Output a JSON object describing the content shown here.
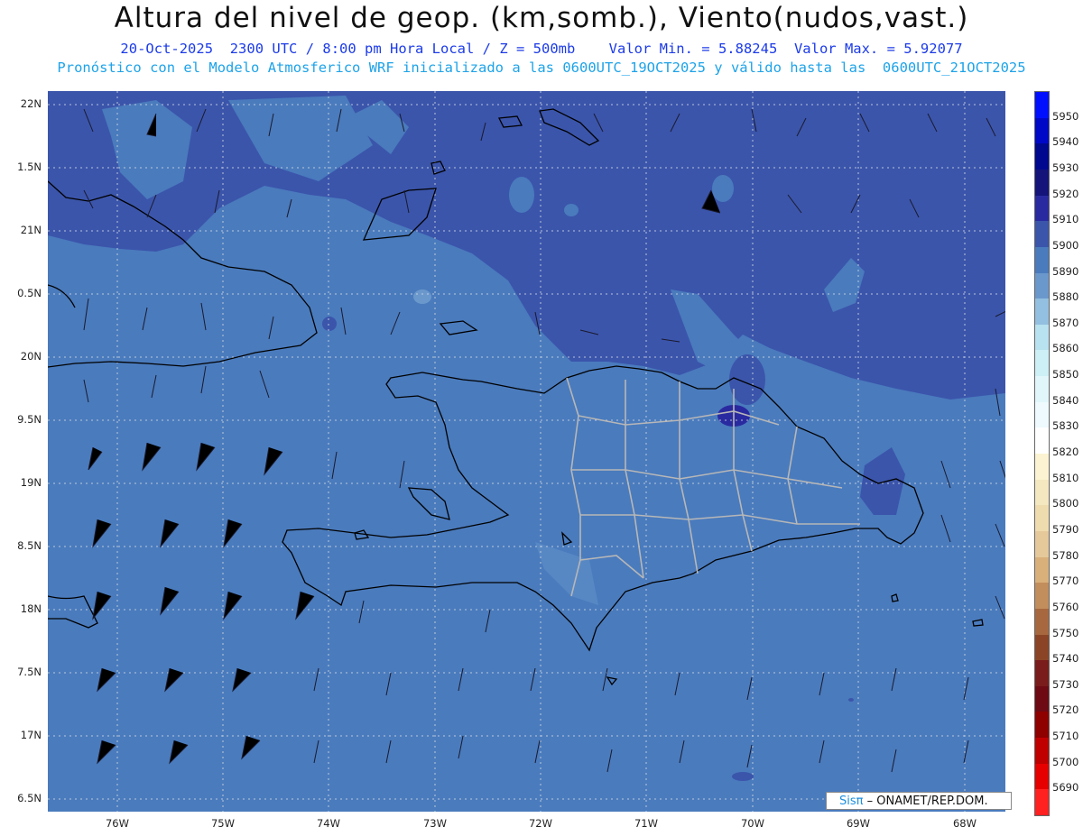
{
  "header": {
    "title": "Altura del nivel de geop. (km,somb.), Viento(nudos,vast.)",
    "line1": "20-Oct-2025  2300 UTC / 8:00 pm Hora Local / Z = 500mb    Valor Min. = 5.88245  Valor Max. = 5.92077",
    "line2": "Pronóstico con el Modelo Atmosferico WRF inicializado a las 0600UTC_19OCT2025 y válido hasta las  0600UTC_21OCT2025"
  },
  "axes": {
    "lat_labels": [
      "22N",
      "1.5N",
      "21N",
      "0.5N",
      "20N",
      "9.5N",
      "19N",
      "8.5N",
      "18N",
      "7.5N",
      "17N",
      "6.5N"
    ],
    "lon_labels": [
      "76W",
      "75W",
      "74W",
      "73W",
      "72W",
      "71W",
      "70W",
      "69W",
      "68W"
    ]
  },
  "colorbar": {
    "labels": [
      "5950",
      "5940",
      "5930",
      "5920",
      "5910",
      "5900",
      "5890",
      "5880",
      "5870",
      "5860",
      "5850",
      "5840",
      "5830",
      "5820",
      "5810",
      "5800",
      "5790",
      "5780",
      "5770",
      "5760",
      "5750",
      "5740",
      "5730",
      "5720",
      "5710",
      "5700",
      "5690"
    ],
    "colors": [
      "#0010ff",
      "#0008c8",
      "#00088f",
      "#14147a",
      "#2a2aa0",
      "#3b55ab",
      "#4a7bbd",
      "#6b98cc",
      "#93bfe0",
      "#b8e2f0",
      "#cdeff6",
      "#e0f6fb",
      "#eefafd",
      "#ffffff",
      "#fbf3d2",
      "#f4e8c0",
      "#efdcae",
      "#e5c99a",
      "#d9b07a",
      "#c28e5c",
      "#a8683f",
      "#8b4526",
      "#7a1c1c",
      "#6d0a14",
      "#8f0000",
      "#c00000",
      "#e60000",
      "#ff2020"
    ]
  },
  "map": {
    "fill_colors": {
      "base": "#4a7bbd",
      "dark": "#3b55ab",
      "darker": "#2a2aa0",
      "light": "#6b98cc"
    }
  },
  "credit": {
    "sis": "Sisπ",
    "org": " – ONAMET/REP.DOM."
  }
}
